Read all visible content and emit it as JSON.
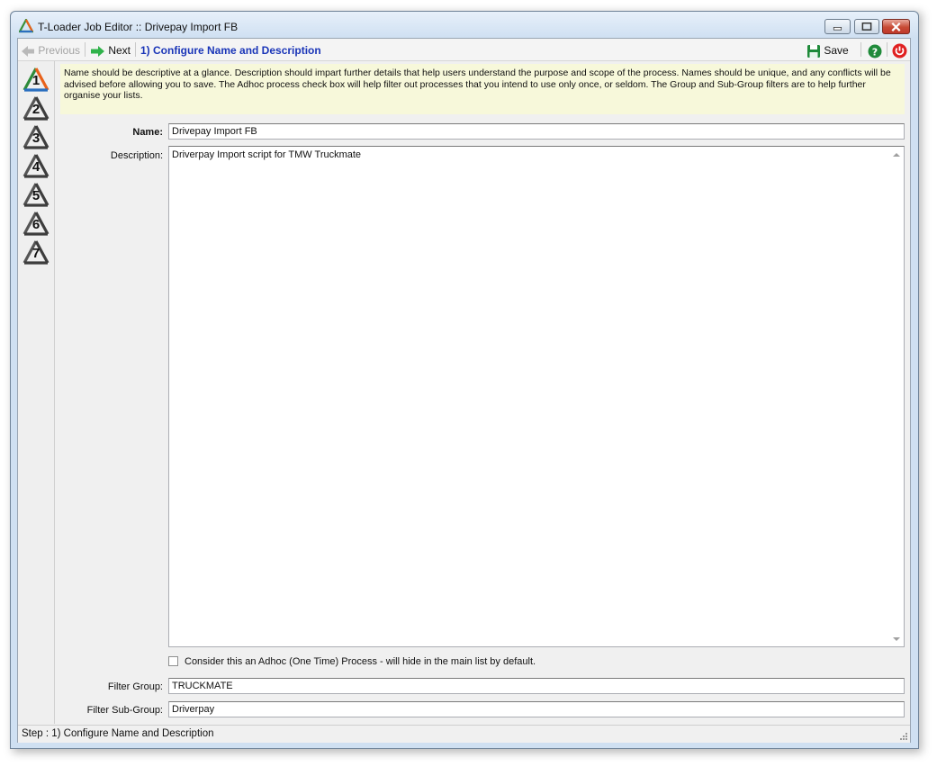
{
  "window": {
    "title": "T-Loader Job Editor :: Drivepay Import FB"
  },
  "toolbar": {
    "previous_label": "Previous",
    "next_label": "Next",
    "step_title": "1) Configure Name and Description",
    "save_label": "Save",
    "help_icon": "help-icon",
    "power_icon": "power-icon"
  },
  "steps": [
    {
      "label": "1",
      "active": true
    },
    {
      "label": "2",
      "active": false
    },
    {
      "label": "3",
      "active": false
    },
    {
      "label": "4",
      "active": false
    },
    {
      "label": "5",
      "active": false
    },
    {
      "label": "6",
      "active": false
    },
    {
      "label": "7",
      "active": false
    }
  ],
  "info_text": "Name should be descriptive at a glance. Description should impart further details that help users understand the purpose and scope of the process. Names should be unique, and any conflicts will be advised before allowing you to save. The Adhoc process check box will help filter out processes that you intend to use only once, or seldom. The Group and Sub-Group filters are to help further organise your lists.",
  "form": {
    "name_label": "Name:",
    "name_value": "Drivepay Import FB",
    "description_label": "Description:",
    "description_value": "Driverpay Import script for TMW Truckmate",
    "adhoc_label": "Consider this an Adhoc (One Time) Process - will hide in the main list by default.",
    "adhoc_checked": false,
    "filter_group_label": "Filter Group:",
    "filter_group_value": "TRUCKMATE",
    "filter_subgroup_label": "Filter Sub-Group:",
    "filter_subgroup_value": "Driverpay"
  },
  "status": {
    "text": "Step : 1) Configure Name and Description"
  },
  "colors": {
    "step_title": "#1a35b8",
    "info_background": "#f7f8da",
    "next_arrow": "#2fb24a",
    "save_icon": "#1f8a3a",
    "help_icon": "#1f8a3a",
    "power_icon": "#e02020",
    "active_step": "#e8611a"
  }
}
